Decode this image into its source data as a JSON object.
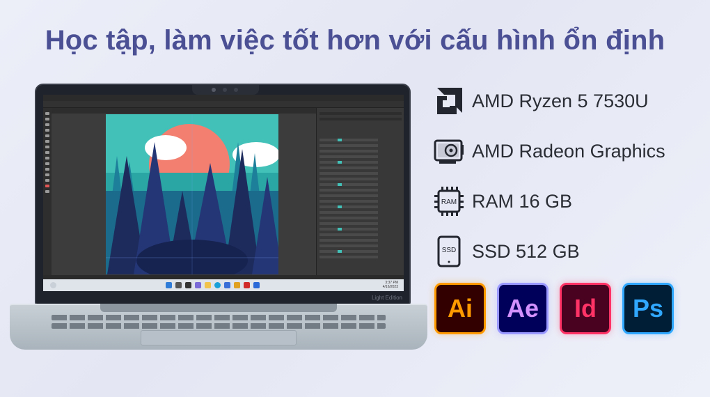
{
  "headline": "Học tập, làm việc tốt hơn với cấu hình ổn định",
  "specs": [
    {
      "label": "AMD Ryzen 5 7530U",
      "icon": "amd-logo-icon"
    },
    {
      "label": "AMD Radeon Graphics",
      "icon": "graphics-card-icon"
    },
    {
      "label": "RAM 16 GB",
      "icon": "ram-chip-icon",
      "chip_text": "RAM"
    },
    {
      "label": "SSD 512 GB",
      "icon": "ssd-drive-icon",
      "chip_text": "SSD"
    }
  ],
  "apps": [
    {
      "label": "Ai",
      "name": "illustrator",
      "bg": "#330000",
      "fg": "#ff9a00",
      "border": "#ff9a00"
    },
    {
      "label": "Ae",
      "name": "after-effects",
      "bg": "#00005b",
      "fg": "#d291ff",
      "border": "#9999ff"
    },
    {
      "label": "Id",
      "name": "indesign",
      "bg": "#49021f",
      "fg": "#ff3366",
      "border": "#ff3366"
    },
    {
      "label": "Ps",
      "name": "photoshop",
      "bg": "#001e36",
      "fg": "#31a8ff",
      "border": "#31a8ff"
    }
  ],
  "laptop": {
    "clock_time": "3:37 PM",
    "clock_date": "4/16/2023",
    "brand": "Light Edition"
  },
  "colors": {
    "headline": "#4b4f94",
    "sky_teal": "#41c1b8",
    "sun": "#f27f6f",
    "forest_dark": "#1d2a5c"
  }
}
